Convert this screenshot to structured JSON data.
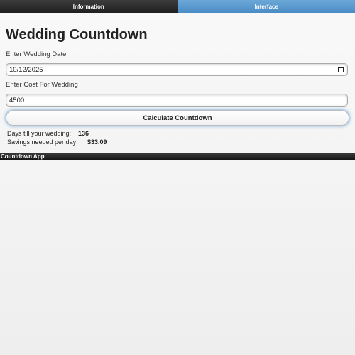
{
  "tabs": [
    {
      "label": "Information",
      "active": false
    },
    {
      "label": "Interface",
      "active": true
    }
  ],
  "title": "Wedding Countdown",
  "date_field": {
    "label": "Enter Wedding Date",
    "value": "10/12/2025"
  },
  "cost_field": {
    "label": "Enter Cost For Wedding",
    "value": "4500"
  },
  "calculate_button": "Calculate Countdown",
  "results": {
    "days_label": "Days till your wedding:",
    "days_value": "136",
    "savings_label": "Savings needed per day:",
    "savings_value": "$33.09"
  },
  "footer_title": "Countdown App",
  "colors": {
    "active_tab": "#5b9bd0",
    "header_dark": "#1e1e1e",
    "button_glow": "#8bb7e2"
  }
}
